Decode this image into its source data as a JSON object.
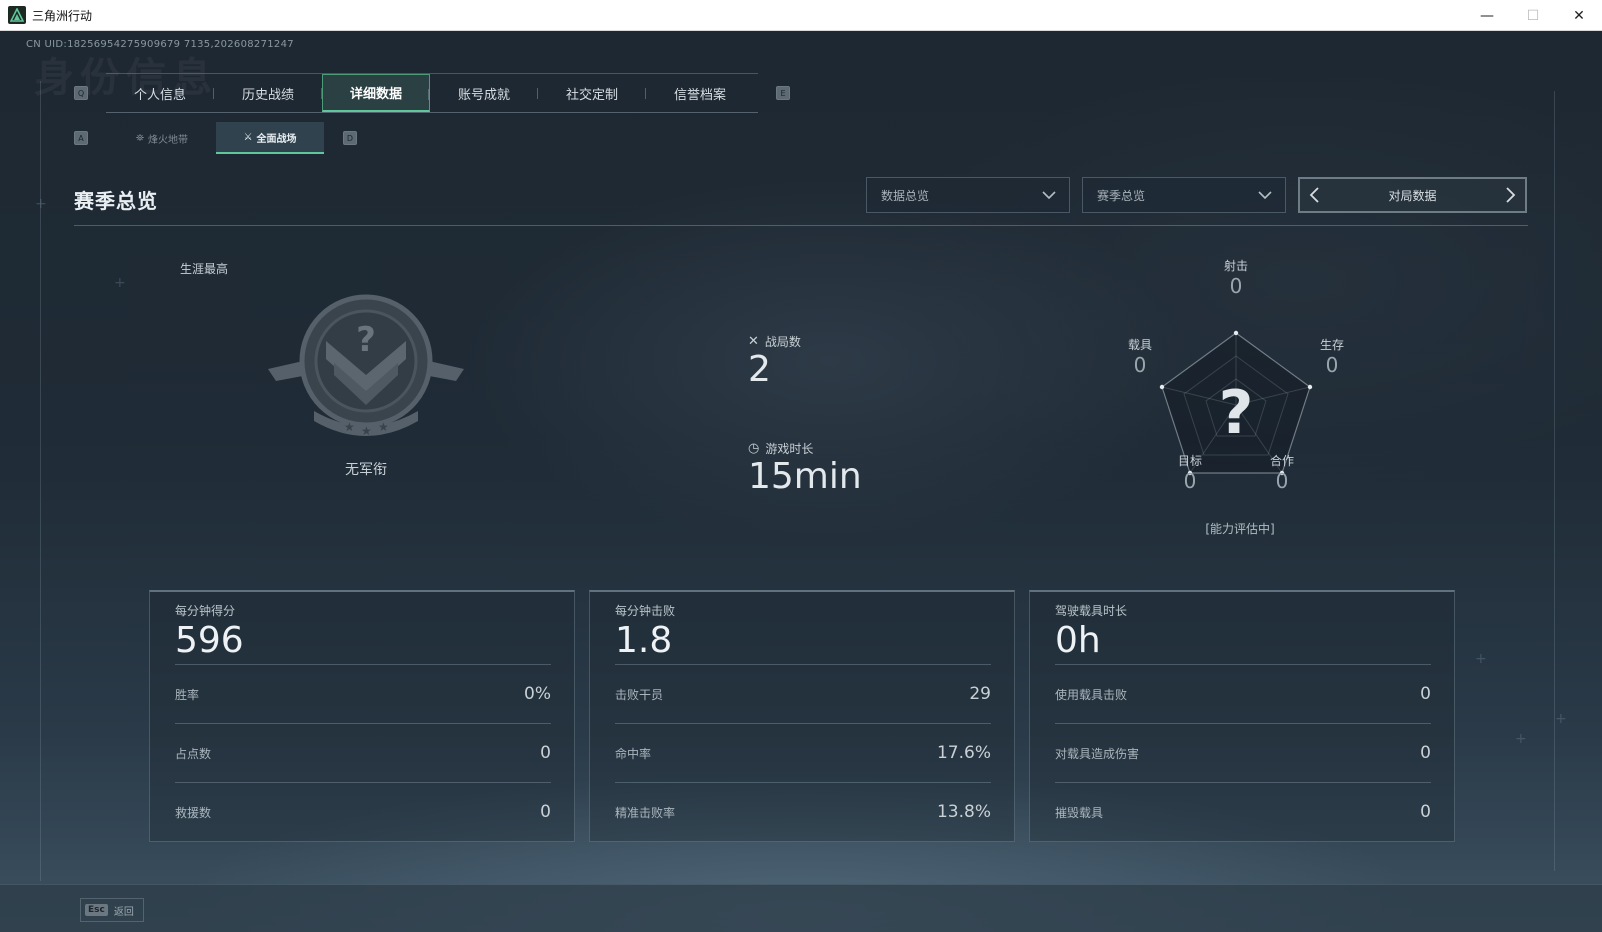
{
  "window": {
    "title": "三角洲行动",
    "minimize": "—",
    "maximize": "☐",
    "close": "✕"
  },
  "uid": "CN UID:18256954275909679 7135,202608271247",
  "watermark": "身份信息",
  "keys": {
    "left_main": "Q",
    "right_main": "E",
    "left_sub": "A",
    "right_sub": "D"
  },
  "main_tabs": [
    {
      "label": "个人信息"
    },
    {
      "label": "历史战绩"
    },
    {
      "label": "详细数据",
      "active": true
    },
    {
      "label": "账号成就"
    },
    {
      "label": "社交定制"
    },
    {
      "label": "信誉档案"
    }
  ],
  "sub_tabs": [
    {
      "label": "烽火地带",
      "icon": "beacon-icon"
    },
    {
      "label": "全面战场",
      "icon": "battlefield-icon",
      "active": true
    }
  ],
  "section": {
    "title": "赛季总览",
    "dropdown1": "数据总览",
    "dropdown2": "赛季总览",
    "pager_label": "对局数据"
  },
  "career": {
    "label": "生涯最高",
    "rank_name": "无军衔"
  },
  "center_stats": {
    "matches_label": "战局数",
    "matches_value": "2",
    "playtime_label": "游戏时长",
    "playtime_value": "15min"
  },
  "radar": {
    "shooting": {
      "label": "射击",
      "value": "0"
    },
    "survival": {
      "label": "生存",
      "value": "0"
    },
    "cooperation": {
      "label": "合作",
      "value": "0"
    },
    "objective": {
      "label": "目标",
      "value": "0"
    },
    "vehicle": {
      "label": "载具",
      "value": "0"
    },
    "note": "[能力评估中]",
    "center_mark": "?"
  },
  "panels": [
    {
      "title": "每分钟得分",
      "big": "596",
      "rows": [
        {
          "label": "胜率",
          "value": "0%"
        },
        {
          "label": "占点数",
          "value": "0"
        },
        {
          "label": "救援数",
          "value": "0"
        }
      ]
    },
    {
      "title": "每分钟击败",
      "big": "1.8",
      "rows": [
        {
          "label": "击败干员",
          "value": "29"
        },
        {
          "label": "命中率",
          "value": "17.6%"
        },
        {
          "label": "精准击败率",
          "value": "13.8%"
        }
      ]
    },
    {
      "title": "驾驶载具时长",
      "big": "0h",
      "rows": [
        {
          "label": "使用载具击败",
          "value": "0"
        },
        {
          "label": "对载具造成伤害",
          "value": "0"
        },
        {
          "label": "摧毁载具",
          "value": "0"
        }
      ]
    }
  ],
  "bottom": {
    "esc_key": "Esc",
    "back_label": "返回"
  },
  "colors": {
    "accent": "#5fc79b",
    "background": "#1f2b36"
  }
}
